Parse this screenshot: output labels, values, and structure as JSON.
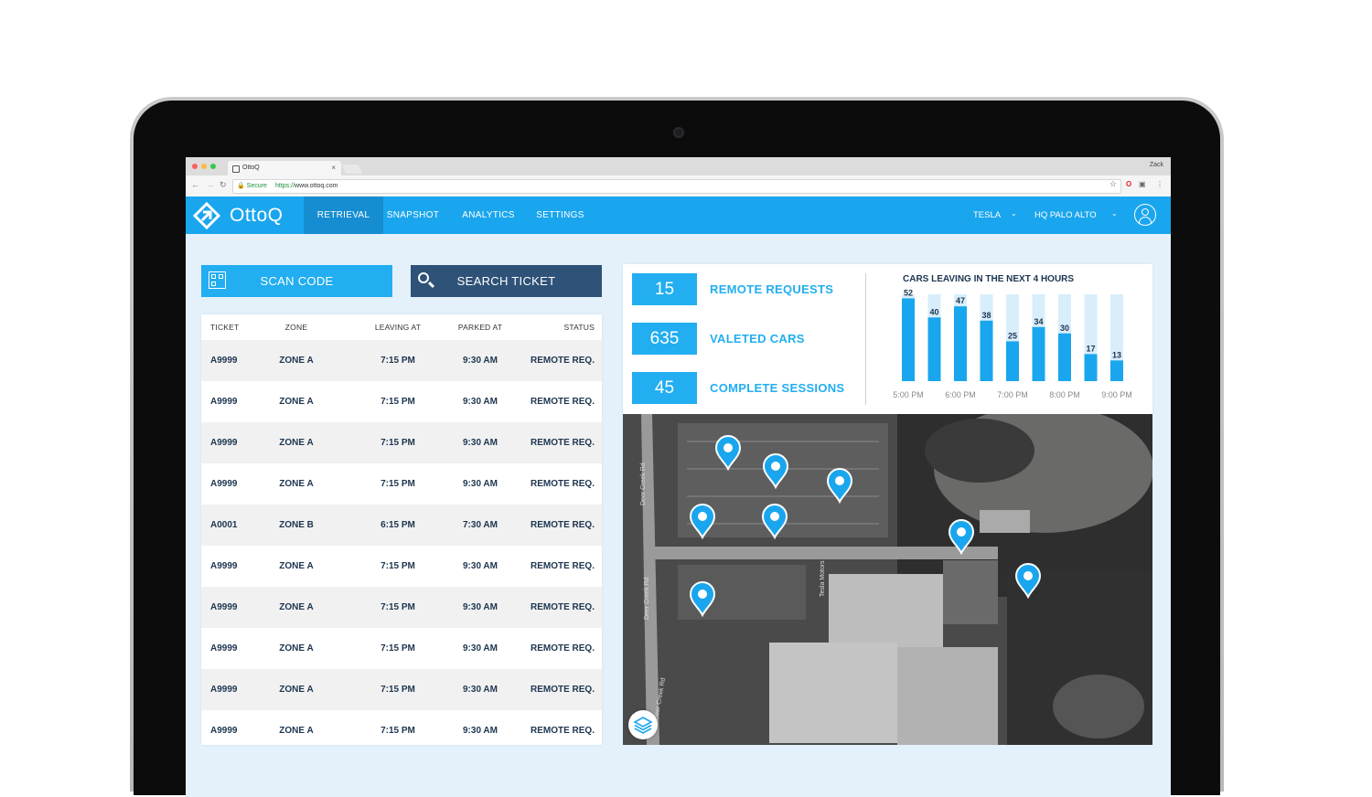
{
  "browser": {
    "tab_title": "OttoQ",
    "tab_close": "×",
    "user": "Zack",
    "secure_label": "Secure",
    "url_scheme": "https://",
    "url_host": "www.ottoq.com",
    "back_icon": "arrow-left-icon",
    "forward_icon": "arrow-right-icon",
    "reload_icon": "reload-icon",
    "star_icon": "star-icon",
    "window_dot_colors": [
      "#fc605c",
      "#fdbc40",
      "#34c84a"
    ]
  },
  "header": {
    "logo_text": "OttoQ",
    "nav": [
      {
        "label": "RETRIEVAL",
        "active": true
      },
      {
        "label": "SNAPSHOT",
        "active": false
      },
      {
        "label": "ANALYTICS",
        "active": false
      },
      {
        "label": "SETTINGS",
        "active": false
      }
    ],
    "account_select": "TESLA",
    "location_select": "HQ PALO ALTO",
    "brand_color": "#1aa6ee",
    "active_tab_color": "#168dd0"
  },
  "actions": {
    "scan_label": "SCAN CODE",
    "search_label": "SEARCH TICKET"
  },
  "tickets": {
    "columns": [
      "TICKET",
      "ZONE",
      "LEAVING AT",
      "PARKED AT",
      "STATUS"
    ],
    "rows": [
      [
        "A9999",
        "ZONE A",
        "7:15 PM",
        "9:30 AM",
        "REMOTE REQ."
      ],
      [
        "A9999",
        "ZONE A",
        "7:15 PM",
        "9:30 AM",
        "REMOTE REQ."
      ],
      [
        "A9999",
        "ZONE A",
        "7:15 PM",
        "9:30 AM",
        "REMOTE REQ."
      ],
      [
        "A9999",
        "ZONE A",
        "7:15 PM",
        "9:30 AM",
        "REMOTE REQ."
      ],
      [
        "A0001",
        "ZONE B",
        "6:15 PM",
        "7:30 AM",
        "REMOTE REQ."
      ],
      [
        "A9999",
        "ZONE A",
        "7:15 PM",
        "9:30 AM",
        "REMOTE REQ."
      ],
      [
        "A9999",
        "ZONE A",
        "7:15 PM",
        "9:30 AM",
        "REMOTE REQ."
      ],
      [
        "A9999",
        "ZONE A",
        "7:15 PM",
        "9:30 AM",
        "REMOTE REQ."
      ],
      [
        "A9999",
        "ZONE A",
        "7:15 PM",
        "9:30 AM",
        "REMOTE REQ."
      ],
      [
        "A9999",
        "ZONE A",
        "7:15 PM",
        "9:30 AM",
        "REMOTE REQ."
      ]
    ]
  },
  "stats": [
    {
      "value": "15",
      "label": "REMOTE REQUESTS"
    },
    {
      "value": "635",
      "label": "VALETED CARS"
    },
    {
      "value": "45",
      "label": "COMPLETE SESSIONS"
    }
  ],
  "chart_data": {
    "type": "bar",
    "title": "CARS LEAVING IN THE NEXT 4 HOURS",
    "values": [
      52,
      40,
      47,
      38,
      25,
      34,
      30,
      17,
      13
    ],
    "x_tick_labels": [
      "5:00 PM",
      "6:00 PM",
      "7:00 PM",
      "8:00 PM",
      "9:00 PM"
    ],
    "ylim": [
      0,
      60
    ],
    "bar_color": "#1aa6ee",
    "track_color": "#d9eefb"
  },
  "map": {
    "street_labels": [
      "Deer Creek Rd",
      "Deer Creek Rd",
      "Deer Creek Rd",
      "Tesla Motors"
    ],
    "pin_icon": "map-pin-icon",
    "layers_icon": "layers-icon"
  }
}
